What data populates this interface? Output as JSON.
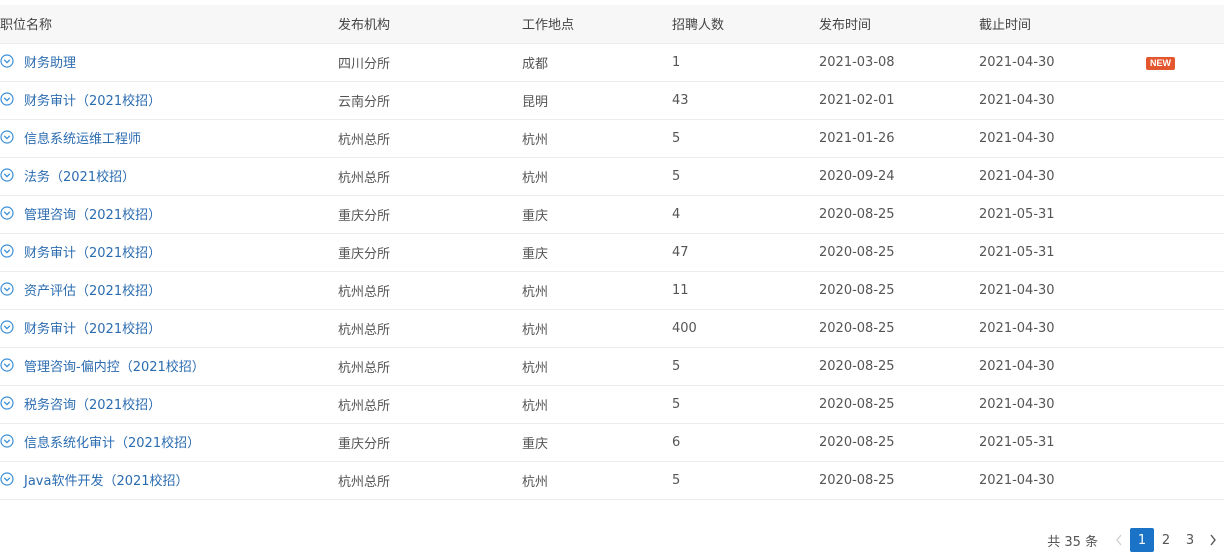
{
  "columns": {
    "name": "职位名称",
    "org": "发布机构",
    "location": "工作地点",
    "count": "招聘人数",
    "published": "发布时间",
    "deadline": "截止时间"
  },
  "rows": [
    {
      "name": "财务助理",
      "org": "四川分所",
      "location": "成都",
      "count": "1",
      "published": "2021-03-08",
      "deadline": "2021-04-30",
      "badge": "NEW"
    },
    {
      "name": "财务审计（2021校招）",
      "org": "云南分所",
      "location": "昆明",
      "count": "43",
      "published": "2021-02-01",
      "deadline": "2021-04-30"
    },
    {
      "name": "信息系统运维工程师",
      "org": "杭州总所",
      "location": "杭州",
      "count": "5",
      "published": "2021-01-26",
      "deadline": "2021-04-30"
    },
    {
      "name": "法务（2021校招）",
      "org": "杭州总所",
      "location": "杭州",
      "count": "5",
      "published": "2020-09-24",
      "deadline": "2021-04-30"
    },
    {
      "name": "管理咨询（2021校招）",
      "org": "重庆分所",
      "location": "重庆",
      "count": "4",
      "published": "2020-08-25",
      "deadline": "2021-05-31"
    },
    {
      "name": "财务审计（2021校招）",
      "org": "重庆分所",
      "location": "重庆",
      "count": "47",
      "published": "2020-08-25",
      "deadline": "2021-05-31"
    },
    {
      "name": "资产评估（2021校招）",
      "org": "杭州总所",
      "location": "杭州",
      "count": "11",
      "published": "2020-08-25",
      "deadline": "2021-04-30"
    },
    {
      "name": "财务审计（2021校招）",
      "org": "杭州总所",
      "location": "杭州",
      "count": "400",
      "published": "2020-08-25",
      "deadline": "2021-04-30"
    },
    {
      "name": "管理咨询-偏内控（2021校招）",
      "org": "杭州总所",
      "location": "杭州",
      "count": "5",
      "published": "2020-08-25",
      "deadline": "2021-04-30"
    },
    {
      "name": "税务咨询（2021校招）",
      "org": "杭州总所",
      "location": "杭州",
      "count": "5",
      "published": "2020-08-25",
      "deadline": "2021-04-30"
    },
    {
      "name": "信息系统化审计（2021校招）",
      "org": "重庆分所",
      "location": "重庆",
      "count": "6",
      "published": "2020-08-25",
      "deadline": "2021-05-31"
    },
    {
      "name": "Java软件开发（2021校招）",
      "org": "杭州总所",
      "location": "杭州",
      "count": "5",
      "published": "2020-08-25",
      "deadline": "2021-04-30"
    }
  ],
  "pagination": {
    "total_label": "共 35 条",
    "pages": [
      "1",
      "2",
      "3"
    ],
    "current_page": "1",
    "prev_icon": "chevron-left-icon",
    "next_icon": "chevron-right-icon"
  },
  "colors": {
    "link": "#2b6cb0",
    "icon": "#3a8fd9",
    "badge": "#e4572e",
    "active_page": "#1a73c6"
  },
  "icons": {
    "row_expand": "chevron-down-circle-icon"
  }
}
